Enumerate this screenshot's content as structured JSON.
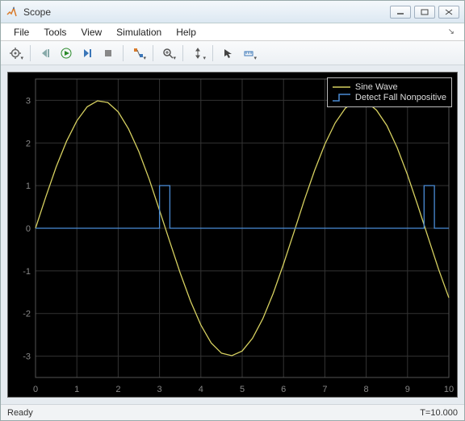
{
  "window": {
    "title": "Scope"
  },
  "menu": {
    "file": "File",
    "tools": "Tools",
    "view": "View",
    "simulation": "Simulation",
    "help": "Help"
  },
  "toolbar": {
    "gear": "Configuration Properties",
    "step_back": "Step Back",
    "run": "Run",
    "step_fwd": "Step Forward",
    "stop": "Stop",
    "highlight": "Highlight",
    "zoom": "Zoom",
    "pan": "Pan",
    "autoscale": "Scale Axes",
    "measure": "Measurements"
  },
  "legend": {
    "series1": "Sine Wave",
    "series2": "Detect Fall Nonpositive"
  },
  "status": {
    "left": "Ready",
    "right": "T=10.000"
  },
  "chart_data": {
    "type": "line",
    "xlabel": "",
    "ylabel": "",
    "xlim": [
      0,
      10
    ],
    "ylim": [
      -3.5,
      3.5
    ],
    "xticks": [
      0,
      1,
      2,
      3,
      4,
      5,
      6,
      7,
      8,
      9,
      10
    ],
    "yticks": [
      -3,
      -2,
      -1,
      0,
      1,
      2,
      3
    ],
    "series": [
      {
        "name": "Sine Wave",
        "color": "#d6d060",
        "x": [
          0,
          0.25,
          0.5,
          0.75,
          1,
          1.25,
          1.5,
          1.75,
          2,
          2.25,
          2.5,
          2.75,
          3,
          3.25,
          3.5,
          3.75,
          4,
          4.25,
          4.5,
          4.75,
          5,
          5.25,
          5.5,
          5.75,
          6,
          6.25,
          6.5,
          6.75,
          7,
          7.25,
          7.5,
          7.75,
          8,
          8.25,
          8.5,
          8.75,
          9,
          9.25,
          9.5,
          9.75,
          10
        ],
        "y": [
          0,
          0.74,
          1.44,
          2.04,
          2.52,
          2.85,
          2.99,
          2.95,
          2.73,
          2.33,
          1.8,
          1.15,
          0.42,
          -0.32,
          -1.05,
          -1.71,
          -2.27,
          -2.69,
          -2.93,
          -2.99,
          -2.88,
          -2.58,
          -2.12,
          -1.53,
          -0.84,
          -0.1,
          0.65,
          1.35,
          1.97,
          2.47,
          2.82,
          2.98,
          2.97,
          2.77,
          2.41,
          1.89,
          1.25,
          0.53,
          -0.22,
          -0.96,
          -1.63
        ]
      },
      {
        "name": "Detect Fall Nonpositive",
        "color": "#4a8cd6",
        "x": [
          0,
          3.0,
          3.0,
          3.25,
          3.25,
          9.4,
          9.4,
          9.65,
          9.65,
          10
        ],
        "y": [
          0,
          0,
          1,
          1,
          0,
          0,
          1,
          1,
          0,
          0
        ]
      }
    ]
  }
}
